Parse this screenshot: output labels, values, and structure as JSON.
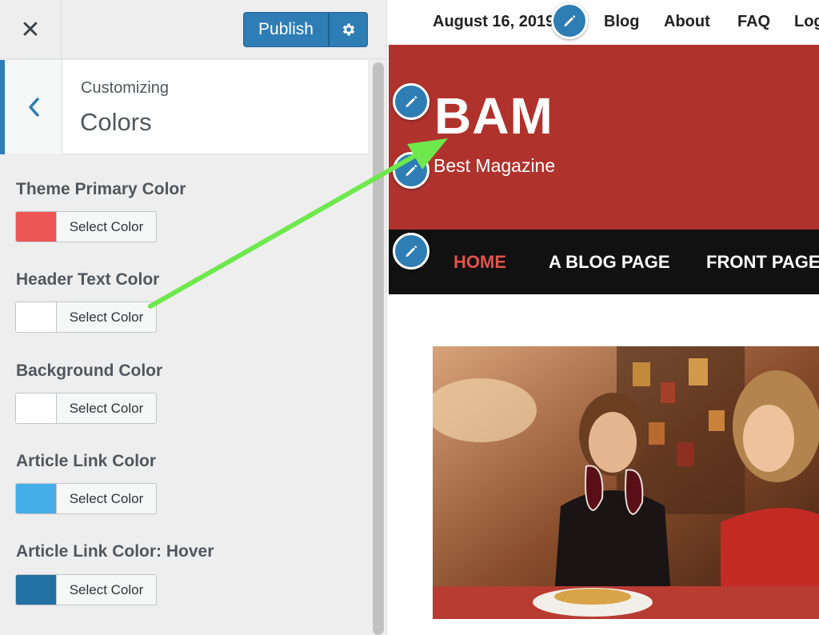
{
  "topbar": {
    "close_icon": "close-icon",
    "publish_label": "Publish",
    "settings_icon": "gear-icon"
  },
  "section": {
    "back_icon": "chevron-left-icon",
    "customizing_label": "Customizing",
    "title": "Colors"
  },
  "controls": [
    {
      "label": "Theme Primary Color",
      "button_label": "Select Color",
      "swatch_color": "#ee5555"
    },
    {
      "label": "Header Text Color",
      "button_label": "Select Color",
      "swatch_color": "#ffffff"
    },
    {
      "label": "Background Color",
      "button_label": "Select Color",
      "swatch_color": "#ffffff"
    },
    {
      "label": "Article Link Color",
      "button_label": "Select Color",
      "swatch_color": "#45aee8"
    },
    {
      "label": "Article Link Color: Hover",
      "button_label": "Select Color",
      "swatch_color": "#2370a3"
    }
  ],
  "preview": {
    "date": "August 16, 2019",
    "top_nav": [
      "Blog",
      "About",
      "FAQ",
      "Log"
    ],
    "site_title": "BAM",
    "site_description": "Best Magazine",
    "menu": [
      "HOME",
      "A BLOG PAGE",
      "FRONT PAGE"
    ],
    "header_bg_color": "#b0322d",
    "menu_bg_color": "#111111",
    "menu_active_color": "#e1524d",
    "image_alt": "two-women-toasting-wine-photo"
  },
  "colors": {
    "accent": "#2e7db5",
    "arrow": "#6ee84d"
  }
}
